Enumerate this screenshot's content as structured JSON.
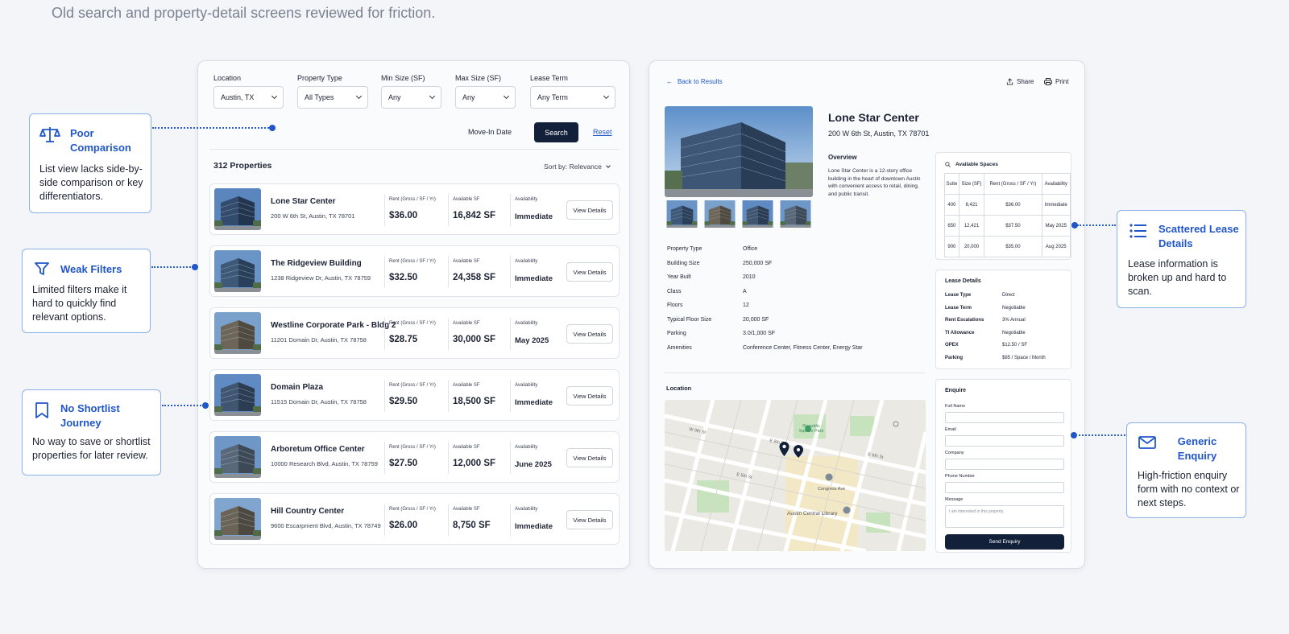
{
  "caption": "Old search and property-detail screens reviewed for friction.",
  "search": {
    "filters": [
      {
        "label": "Location",
        "value": "Austin, TX"
      },
      {
        "label": "Property Type",
        "value": "All Types"
      },
      {
        "label": "Min Size (SF)",
        "value": "Any"
      },
      {
        "label": "Max Size (SF)",
        "value": "Any"
      },
      {
        "label": "Lease Term",
        "value": "Any Term"
      }
    ],
    "move_in": "Move-In Date",
    "search_button": "Search",
    "reset_link": "Reset",
    "count": "312 Properties",
    "sort": "Sort by: Relevance",
    "col_rent": "Rent (Gross / SF / Yr)",
    "col_sf": "Available SF",
    "col_avail": "Availability",
    "view_details": "View Details",
    "rows": [
      {
        "name": "Lone Star Center",
        "address": "200 W 6th St, Austin, TX 78701",
        "rent": "$36.00",
        "sf": "16,842 SF",
        "avail": "Immediate"
      },
      {
        "name": "The Ridgeview Building",
        "address": "1238 Ridgeview Dr, Austin, TX 78759",
        "rent": "$32.50",
        "sf": "24,358 SF",
        "avail": "Immediate"
      },
      {
        "name": "Westline Corporate Park - Bldg 2",
        "address": "11201 Domain Dr, Austin, TX 78758",
        "rent": "$28.75",
        "sf": "30,000 SF",
        "avail": "May 2025"
      },
      {
        "name": "Domain Plaza",
        "address": "11515 Domain Dr, Austin, TX 78758",
        "rent": "$29.50",
        "sf": "18,500 SF",
        "avail": "Immediate"
      },
      {
        "name": "Arboretum Office Center",
        "address": "10000 Research Blvd, Austin, TX 78759",
        "rent": "$27.50",
        "sf": "12,000 SF",
        "avail": "June 2025"
      },
      {
        "name": "Hill Country Center",
        "address": "9600 Escarpment Blvd, Austin, TX 78749",
        "rent": "$26.00",
        "sf": "8,750 SF",
        "avail": "Immediate"
      }
    ]
  },
  "callouts": {
    "comparison": {
      "title": "Poor Comparison",
      "body": "List view lacks side-by-side comparison or key differentiators."
    },
    "filters": {
      "title": "Weak Filters",
      "body": "Limited filters make it hard to quickly find relevant options."
    },
    "shortlist": {
      "title": "No Shortlist Journey",
      "body": "No way to save or shortlist properties for later review."
    },
    "lease": {
      "title": "Scattered Lease Details",
      "body": "Lease information is broken up and hard to scan."
    },
    "enquiry": {
      "title": "Generic Enquiry",
      "body": "High-friction enquiry form with no context or next steps."
    }
  },
  "detail": {
    "back": "Back to Results",
    "share": "Share",
    "print": "Print",
    "name": "Lone Star Center",
    "address": "200 W 6th St, Austin, TX 78701",
    "overview_title": "Overview",
    "overview_text": "Lone Star Center is a 12-story office building in the heart of downtown Austin with convenient access to retail, dining, and public transit.",
    "specs": [
      {
        "k": "Property Type",
        "v": "Office"
      },
      {
        "k": "Building Size",
        "v": "250,000 SF"
      },
      {
        "k": "Year Built",
        "v": "2010"
      },
      {
        "k": "Class",
        "v": "A"
      },
      {
        "k": "Floors",
        "v": "12"
      },
      {
        "k": "Typical Floor Size",
        "v": "20,000 SF"
      },
      {
        "k": "Parking",
        "v": "3.0/1,000 SF"
      },
      {
        "k": "Amenities",
        "v": "Conference Center, Fitness Center, Energy Star"
      }
    ],
    "spaces_title": "Available Spaces",
    "spaces_head": [
      "Suite",
      "Size (SF)",
      "Rent (Gross / SF / Yr)",
      "Availability"
    ],
    "spaces": [
      [
        "400",
        "8,421",
        "$36.00",
        "Immediate"
      ],
      [
        "650",
        "12,421",
        "$37.50",
        "May 2025"
      ],
      [
        "900",
        "20,000",
        "$35.00",
        "Aug 2025"
      ]
    ],
    "lease_title": "Lease Details",
    "lease": [
      {
        "k": "Lease Type",
        "v": "Direct"
      },
      {
        "k": "Lease Term",
        "v": "Negotiable"
      },
      {
        "k": "Rent Escalations",
        "v": "3% Annual"
      },
      {
        "k": "TI Allowance",
        "v": "Negotiable"
      },
      {
        "k": "OPEX",
        "v": "$12.50 / SF"
      },
      {
        "k": "Parking",
        "v": "$85 / Space / Month"
      }
    ],
    "location_title": "Location",
    "map_labels": {
      "park": "Republic Square Park",
      "library": "Austin Central Library",
      "e5": "E 5th St",
      "e6": "E 6th St",
      "e8": "E 8th St",
      "congress": "Congress Ave",
      "ninth": "W 9th St"
    },
    "enquire": {
      "title": "Enquire",
      "full_name": "Full Name",
      "email": "Email",
      "company": "Company",
      "phone": "Phone Number",
      "message": "Message",
      "message_placeholder": "I am interested in this property.",
      "send": "Send Enquiry"
    }
  },
  "colors": {
    "accent": "#2056c9",
    "navy": "#13203a"
  }
}
